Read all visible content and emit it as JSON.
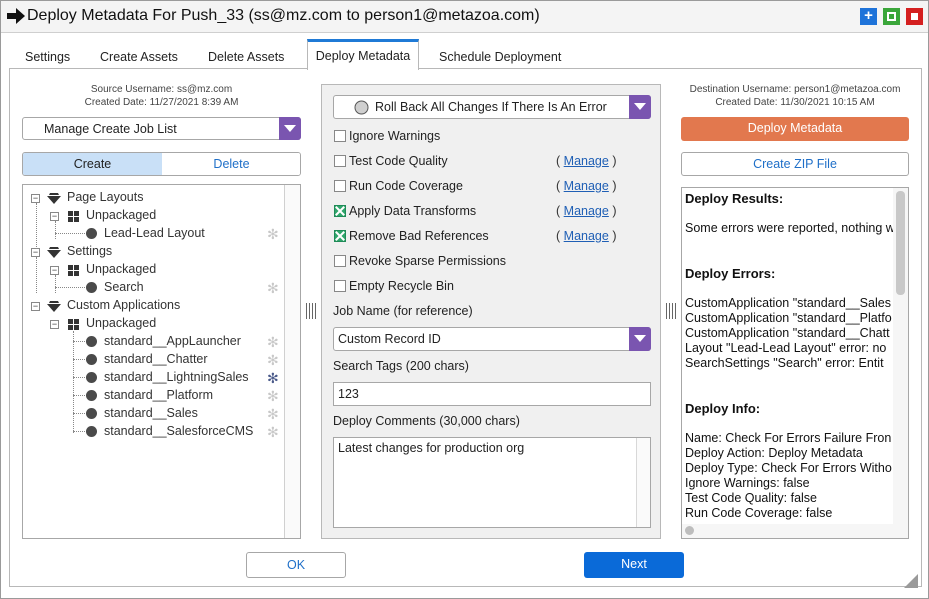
{
  "window": {
    "title": "Deploy Metadata For Push_33 (ss@mz.com to person1@metazoa.com)",
    "icons": [
      "arrow-right-icon",
      "add-icon",
      "maximize-icon",
      "close-icon"
    ]
  },
  "tabs": [
    {
      "label": "Settings",
      "active": false
    },
    {
      "label": "Create Assets",
      "active": false
    },
    {
      "label": "Delete Assets",
      "active": false
    },
    {
      "label": "Deploy Metadata",
      "active": true
    },
    {
      "label": "Schedule Deployment",
      "active": false
    }
  ],
  "source": {
    "username": "Source Username: ss@mz.com",
    "created": "Created Date: 11/27/2021 8:39 AM",
    "job_list": "Manage Create Job List",
    "create_label": "Create",
    "delete_label": "Delete"
  },
  "tree": {
    "groups": [
      {
        "label": "Page Layouts",
        "sub": "Unpackaged",
        "items": [
          "Lead-Lead Layout"
        ]
      },
      {
        "label": "Settings",
        "sub": "Unpackaged",
        "items": [
          "Search"
        ]
      },
      {
        "label": "Custom Applications",
        "sub": "Unpackaged",
        "items": [
          "standard__AppLauncher",
          "standard__Chatter",
          "standard__LightningSales",
          "standard__Platform",
          "standard__Sales",
          "standard__SalesforceCMS"
        ]
      }
    ]
  },
  "options": {
    "rollback": "Roll Back All Changes If There Is An Error",
    "checkboxes": [
      {
        "label": "Ignore Warnings",
        "checked": false,
        "manage": false
      },
      {
        "label": "Test Code Quality",
        "checked": false,
        "manage": true
      },
      {
        "label": "Run Code Coverage",
        "checked": false,
        "manage": true
      },
      {
        "label": "Apply Data Transforms",
        "checked": true,
        "manage": true
      },
      {
        "label": "Remove Bad References",
        "checked": true,
        "manage": true
      },
      {
        "label": "Revoke Sparse Permissions",
        "checked": false,
        "manage": false
      },
      {
        "label": "Empty Recycle Bin",
        "checked": false,
        "manage": false
      }
    ],
    "manage_open": "(",
    "manage_label": "Manage",
    "manage_close": ")",
    "job_name_label": "Job Name (for reference)",
    "job_name_value": "Custom Record ID",
    "search_tags_label": "Search Tags (200 chars)",
    "search_tags_value": "123",
    "comments_label": "Deploy Comments (30,000 chars)",
    "comments_value": "Latest changes for production org"
  },
  "destination": {
    "username": "Destination Username: person1@metazoa.com",
    "created": "Created Date: 11/30/2021 10:15 AM",
    "deploy_button": "Deploy Metadata",
    "zip_button": "Create ZIP File",
    "deploy_button_color": "#e2784e"
  },
  "results": {
    "results_heading": "Deploy Results:",
    "results_text": "Some errors were reported, nothing w",
    "errors_heading": "Deploy Errors:",
    "errors": [
      "CustomApplication \"standard__Sales",
      "CustomApplication \"standard__Platfo",
      "CustomApplication \"standard__Chatt",
      "Layout \"Lead-Lead Layout\" error: no",
      "SearchSettings \"Search\" error: Entit"
    ],
    "info_heading": "Deploy Info:",
    "info": [
      "Name: Check For Errors Failure Fron",
      "Deploy Action: Deploy Metadata",
      "Deploy Type: Check For Errors Witho",
      "Ignore Warnings: false",
      "Test Code Quality: false",
      "Run Code Coverage: false"
    ]
  },
  "footer": {
    "ok_label": "OK",
    "next_label": "Next",
    "next_color": "#0a6ad8"
  }
}
